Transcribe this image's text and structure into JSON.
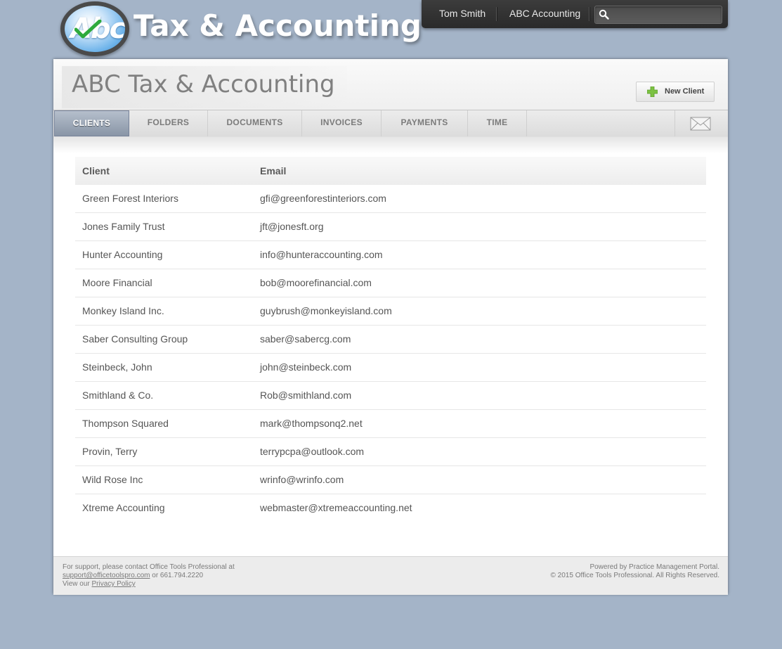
{
  "logo": {
    "badge_text": "Abc",
    "title": "Tax & Accounting"
  },
  "userbar": {
    "user_name": "Tom Smith",
    "account_name": "ABC Accounting",
    "search_placeholder": "",
    "search_value": "",
    "search_icon": "magnifier-icon"
  },
  "header": {
    "page_title": "ABC Tax & Accounting",
    "new_client_label": "New Client",
    "new_client_icon": "green-plus-icon"
  },
  "nav": {
    "tabs": [
      {
        "label": "CLIENTS",
        "active": true
      },
      {
        "label": "FOLDERS",
        "active": false
      },
      {
        "label": "DOCUMENTS",
        "active": false
      },
      {
        "label": "INVOICES",
        "active": false
      },
      {
        "label": "PAYMENTS",
        "active": false
      },
      {
        "label": "TIME",
        "active": false
      }
    ],
    "mail_icon": "envelope-icon"
  },
  "clients_table": {
    "headers": {
      "client": "Client",
      "email": "Email"
    },
    "rows": [
      {
        "client": "Green Forest Interiors",
        "email": "gfi@greenforestinteriors.com"
      },
      {
        "client": "Jones Family Trust",
        "email": "jft@jonesft.org"
      },
      {
        "client": "Hunter Accounting",
        "email": "info@hunteraccounting.com"
      },
      {
        "client": "Moore Financial",
        "email": "bob@moorefinancial.com"
      },
      {
        "client": "Monkey Island Inc.",
        "email": "guybrush@monkeyisland.com"
      },
      {
        "client": "Saber Consulting Group",
        "email": "saber@sabercg.com"
      },
      {
        "client": "Steinbeck, John",
        "email": "john@steinbeck.com"
      },
      {
        "client": "Smithland & Co.",
        "email": "Rob@smithland.com"
      },
      {
        "client": "Thompson Squared",
        "email": "mark@thompsonq2.net"
      },
      {
        "client": "Provin, Terry",
        "email": "terrypcpa@outlook.com"
      },
      {
        "client": "Wild Rose Inc",
        "email": "wrinfo@wrinfo.com"
      },
      {
        "client": "Xtreme Accounting",
        "email": "webmaster@xtremeaccounting.net"
      }
    ]
  },
  "footer": {
    "support_text": "For support, please contact Office Tools Professional at",
    "support_email": "support@officetoolspro.com",
    "phone_text": " or 661.794.2220",
    "view_text": "View our ",
    "privacy_label": "Privacy Policy",
    "powered_by": "Powered by Practice Management Portal.",
    "copyright": "© 2015 Office Tools Professional. All Rights Reserved."
  },
  "colors": {
    "page_background": "#a4b4c8",
    "active_tab": "#8995a6",
    "plus_green": "#7cc242",
    "check_green": "#2eaa3c"
  }
}
